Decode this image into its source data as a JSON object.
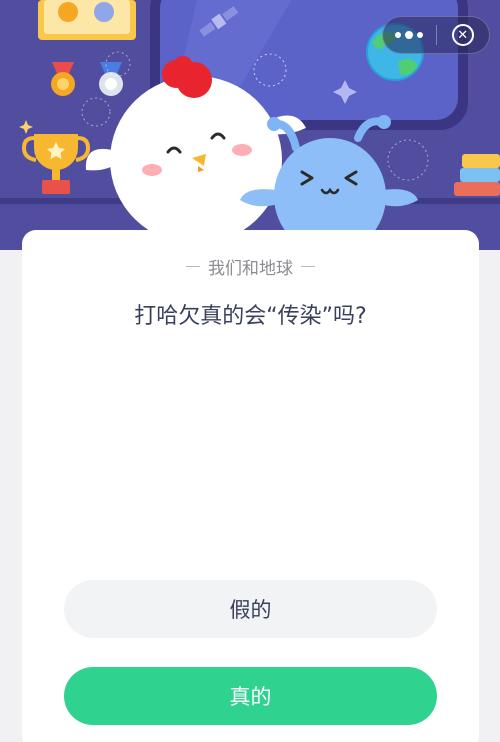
{
  "capsule": {
    "more_icon": "more-dots-icon",
    "close_icon": "close-circle-icon",
    "close_glyph": "✕"
  },
  "quiz": {
    "category": "我们和地球",
    "question": "打哈欠真的会“传染”吗?",
    "options": [
      {
        "label": "假的"
      },
      {
        "label": "真的"
      }
    ]
  },
  "colors": {
    "hero_background": "#4e4a99",
    "true_button": "#2fd28f",
    "false_button": "#f2f3f5",
    "question_text": "#3a3f5c"
  }
}
